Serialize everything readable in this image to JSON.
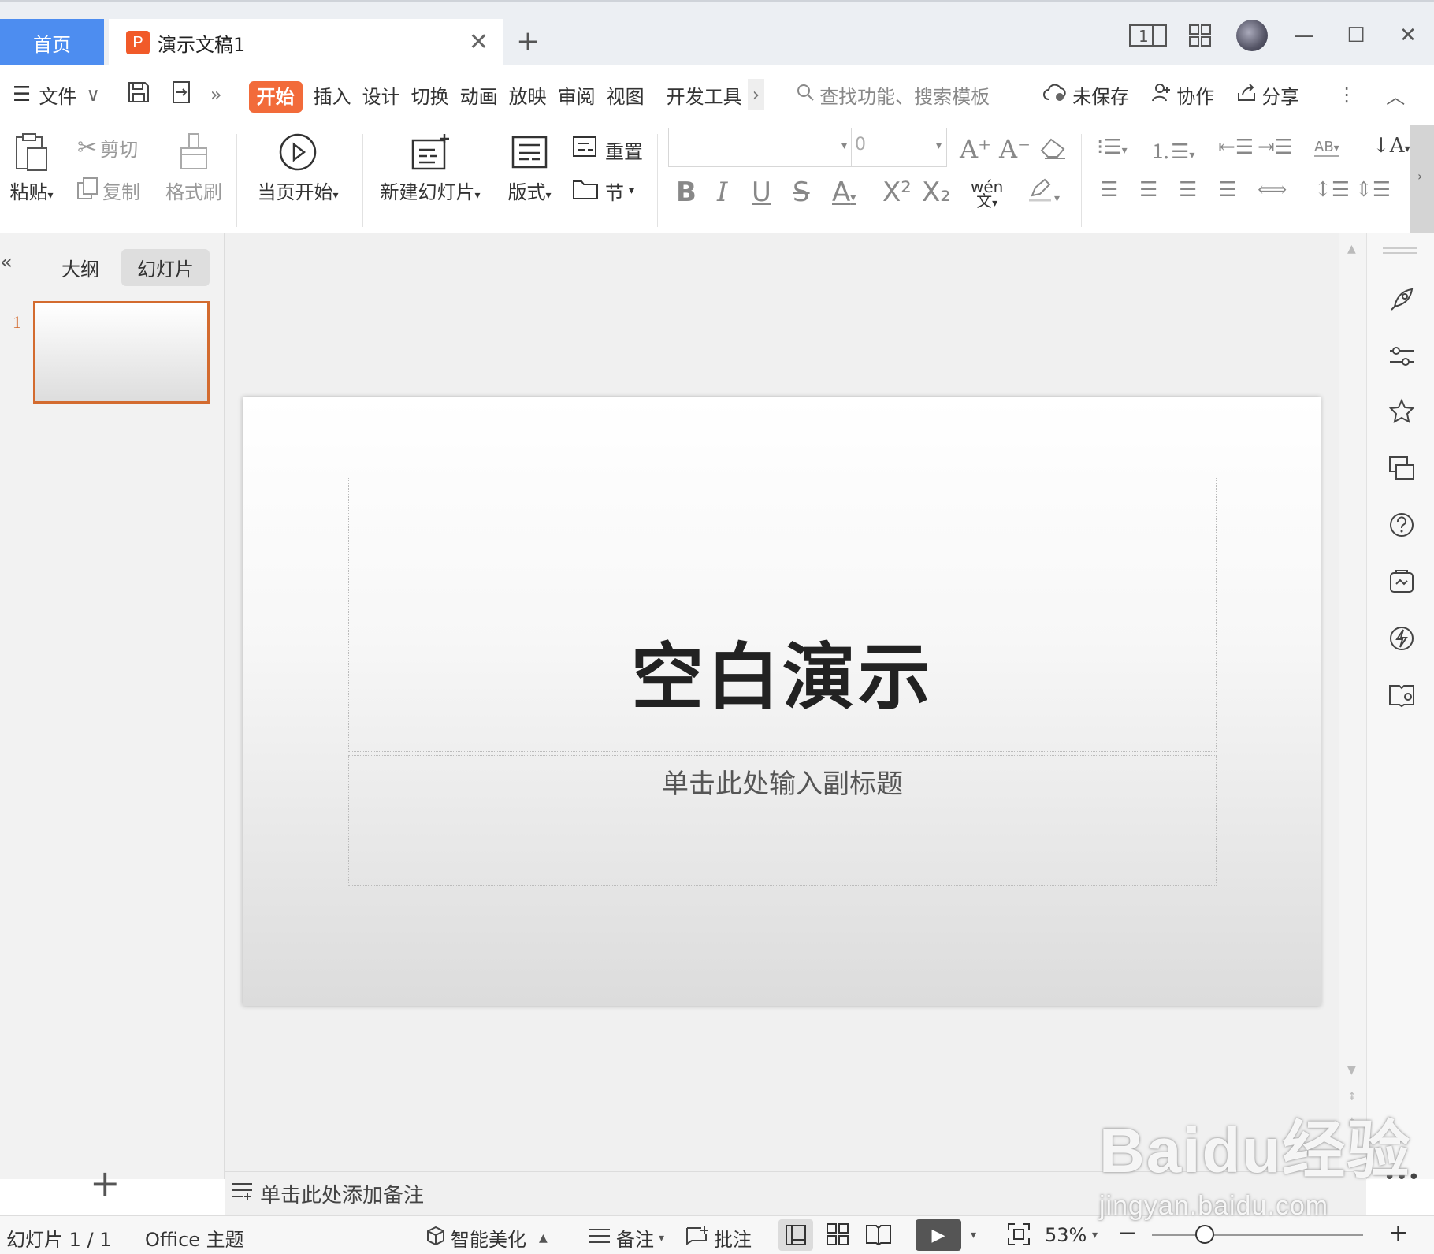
{
  "tabs": {
    "home": "首页",
    "doc_title": "演示文稿1",
    "doc_icon": "P"
  },
  "window": {
    "page_num_icon": "1"
  },
  "menu": {
    "file": "文件",
    "items": [
      "开始",
      "插入",
      "设计",
      "切换",
      "动画",
      "放映",
      "审阅",
      "视图",
      "开发工具"
    ],
    "search_placeholder": "查找功能、搜索模板",
    "unsaved": "未保存",
    "collab": "协作",
    "share": "分享"
  },
  "ribbon": {
    "paste": "粘贴",
    "cut": "剪切",
    "copy": "复制",
    "format_painter": "格式刷",
    "start_from_current": "当页开始",
    "new_slide": "新建幻灯片",
    "layout": "版式",
    "reset": "重置",
    "section": "节",
    "font_size_value": "0",
    "phonetic": "wén"
  },
  "left_pane": {
    "outline_tab": "大纲",
    "slides_tab": "幻灯片",
    "slide_number": "1"
  },
  "slide": {
    "title": "空白演示",
    "subtitle_placeholder": "单击此处输入副标题"
  },
  "notes": {
    "placeholder": "单击此处添加备注"
  },
  "status": {
    "slide_info": "幻灯片 1 / 1",
    "theme": "Office 主题",
    "beautify": "智能美化",
    "notes": "备注",
    "comments": "批注",
    "zoom": "53%"
  },
  "watermark": {
    "brand": "Baidu经验",
    "url": "jingyan.baidu.com"
  },
  "colors": {
    "accent": "#f26b3a",
    "home_tab": "#4d8df0",
    "thumb_border": "#d36b2f"
  }
}
